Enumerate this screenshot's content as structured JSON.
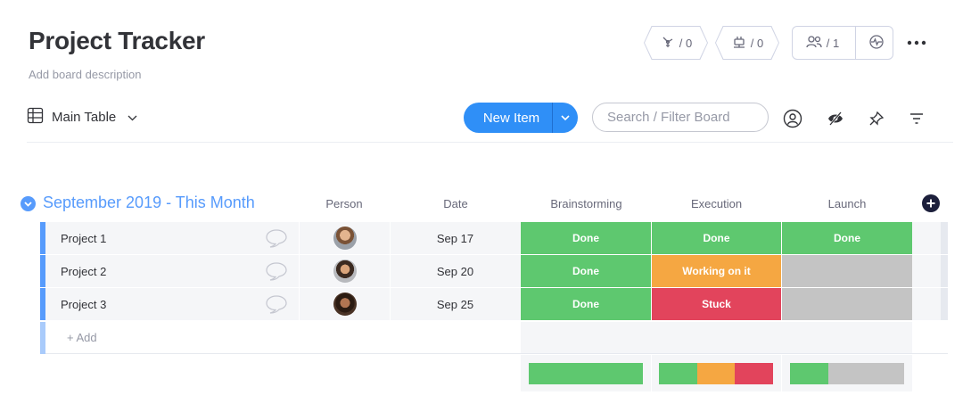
{
  "board": {
    "title": "Project Tracker",
    "description": "Add board description",
    "view": "Main Table"
  },
  "header": {
    "automations_count": "/ 0",
    "integrations_count": "/ 0",
    "members_count": "/ 1"
  },
  "toolbar": {
    "new_item_label": "New Item",
    "search_placeholder": "Search / Filter Board"
  },
  "group": {
    "title": "September 2019 - This Month",
    "color": "#579bfc",
    "columns": {
      "person": "Person",
      "date": "Date",
      "brainstorming": "Brainstorming",
      "execution": "Execution",
      "launch": "Launch"
    },
    "rows": [
      {
        "name": "Project 1",
        "date": "Sep 17",
        "brainstorming": "Done",
        "execution": "Done",
        "launch": "Done"
      },
      {
        "name": "Project 2",
        "date": "Sep 20",
        "brainstorming": "Done",
        "execution": "Working on it",
        "launch": ""
      },
      {
        "name": "Project 3",
        "date": "Sep 25",
        "brainstorming": "Done",
        "execution": "Stuck",
        "launch": ""
      }
    ],
    "add_label": "+ Add"
  },
  "status_colors": {
    "done": "#5ec86f",
    "working": "#f5a742",
    "stuck": "#e2445c",
    "empty": "#c4c4c4"
  },
  "summary": {
    "brainstorming": {
      "done": 1.0
    },
    "execution": {
      "done": 0.333,
      "working": 0.333,
      "stuck": 0.334
    },
    "launch": {
      "done": 0.333,
      "empty": 0.667
    }
  },
  "icons": {
    "automations": "robot-arm-icon",
    "integrations": "plug-icon",
    "members": "people-icon",
    "activity": "pulse-icon",
    "more": "more-dots-icon",
    "table": "table-icon",
    "person_filter": "person-circle-icon",
    "hide": "eye-slash-icon",
    "pin": "pin-icon",
    "filter": "filter-lines-icon",
    "add_column": "plus-circle-icon",
    "collapse": "chevron-circle-icon",
    "comment": "speech-bubble-icon"
  }
}
